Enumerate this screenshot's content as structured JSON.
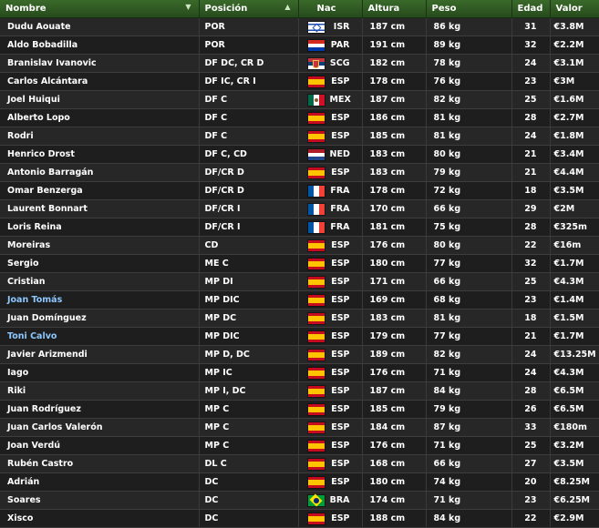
{
  "header": {
    "nombre": "Nombre",
    "posicion": "Posición",
    "nac": "Nac",
    "altura": "Altura",
    "peso": "Peso",
    "edad": "Edad",
    "valor": "Valor"
  },
  "flag_colors": {
    "ISR": [
      "#ffffff",
      "#1f4fb5"
    ],
    "PAR": [
      "#d52b1e",
      "#ffffff",
      "#0038a8"
    ],
    "SCG": [
      "#c6363c",
      "#0c4076",
      "#ffffff"
    ],
    "ESP": [
      "#c60b1e",
      "#ffc400",
      "#c60b1e"
    ],
    "MEX": [
      "#006847",
      "#ffffff",
      "#ce1126"
    ],
    "NED": [
      "#ae1c28",
      "#ffffff",
      "#21468b"
    ],
    "FRA": [
      "#0055a4",
      "#ffffff",
      "#ef4135"
    ],
    "BRA": [
      "#009c3b",
      "#ffdf00",
      "#002776"
    ]
  },
  "players": [
    {
      "name": "Dudu Aouate",
      "pos": "POR",
      "nac": "ISR",
      "altura": "187 cm",
      "peso": "86 kg",
      "edad": "31",
      "valor": "€3.8M",
      "highlight": false
    },
    {
      "name": "Aldo Bobadilla",
      "pos": "POR",
      "nac": "PAR",
      "altura": "191 cm",
      "peso": "89 kg",
      "edad": "32",
      "valor": "€2.2M",
      "highlight": false
    },
    {
      "name": "Branislav Ivanovic",
      "pos": "DF DC, CR D",
      "nac": "SCG",
      "altura": "182 cm",
      "peso": "78 kg",
      "edad": "24",
      "valor": "€3.1M",
      "highlight": false
    },
    {
      "name": "Carlos Alcántara",
      "pos": "DF IC, CR I",
      "nac": "ESP",
      "altura": "178 cm",
      "peso": "76 kg",
      "edad": "23",
      "valor": "€3M",
      "highlight": false
    },
    {
      "name": "Joel Huiqui",
      "pos": "DF C",
      "nac": "MEX",
      "altura": "187 cm",
      "peso": "82 kg",
      "edad": "25",
      "valor": "€1.6M",
      "highlight": false
    },
    {
      "name": "Alberto Lopo",
      "pos": "DF C",
      "nac": "ESP",
      "altura": "186 cm",
      "peso": "81 kg",
      "edad": "28",
      "valor": "€2.7M",
      "highlight": false
    },
    {
      "name": "Rodri",
      "pos": "DF C",
      "nac": "ESP",
      "altura": "185 cm",
      "peso": "81 kg",
      "edad": "24",
      "valor": "€1.8M",
      "highlight": false
    },
    {
      "name": "Henrico Drost",
      "pos": "DF C, CD",
      "nac": "NED",
      "altura": "183 cm",
      "peso": "80 kg",
      "edad": "21",
      "valor": "€3.4M",
      "highlight": false
    },
    {
      "name": "Antonio Barragán",
      "pos": "DF/CR D",
      "nac": "ESP",
      "altura": "183 cm",
      "peso": "79 kg",
      "edad": "21",
      "valor": "€4.4M",
      "highlight": false
    },
    {
      "name": "Omar Benzerga",
      "pos": "DF/CR D",
      "nac": "FRA",
      "altura": "178 cm",
      "peso": "72 kg",
      "edad": "18",
      "valor": "€3.5M",
      "highlight": false
    },
    {
      "name": "Laurent Bonnart",
      "pos": "DF/CR I",
      "nac": "FRA",
      "altura": "170 cm",
      "peso": "66 kg",
      "edad": "29",
      "valor": "€2M",
      "highlight": false
    },
    {
      "name": "Loris Reina",
      "pos": "DF/CR I",
      "nac": "FRA",
      "altura": "181 cm",
      "peso": "75 kg",
      "edad": "28",
      "valor": "€325m",
      "highlight": false
    },
    {
      "name": "Moreiras",
      "pos": "CD",
      "nac": "ESP",
      "altura": "176 cm",
      "peso": "80 kg",
      "edad": "22",
      "valor": "€16m",
      "highlight": false
    },
    {
      "name": "Sergio",
      "pos": "ME C",
      "nac": "ESP",
      "altura": "180 cm",
      "peso": "77 kg",
      "edad": "32",
      "valor": "€1.7M",
      "highlight": false
    },
    {
      "name": "Cristian",
      "pos": "MP DI",
      "nac": "ESP",
      "altura": "171 cm",
      "peso": "66 kg",
      "edad": "25",
      "valor": "€4.3M",
      "highlight": false
    },
    {
      "name": "Joan Tomás",
      "pos": "MP DIC",
      "nac": "ESP",
      "altura": "169 cm",
      "peso": "68 kg",
      "edad": "23",
      "valor": "€1.4M",
      "highlight": true
    },
    {
      "name": "Juan Domínguez",
      "pos": "MP DC",
      "nac": "ESP",
      "altura": "183 cm",
      "peso": "81 kg",
      "edad": "18",
      "valor": "€1.5M",
      "highlight": false
    },
    {
      "name": "Toni Calvo",
      "pos": "MP DIC",
      "nac": "ESP",
      "altura": "179 cm",
      "peso": "77 kg",
      "edad": "21",
      "valor": "€1.7M",
      "highlight": true
    },
    {
      "name": "Javier Arizmendi",
      "pos": "MP D, DC",
      "nac": "ESP",
      "altura": "189 cm",
      "peso": "82 kg",
      "edad": "24",
      "valor": "€13.25M",
      "highlight": false
    },
    {
      "name": "Iago",
      "pos": "MP IC",
      "nac": "ESP",
      "altura": "176 cm",
      "peso": "71 kg",
      "edad": "24",
      "valor": "€4.3M",
      "highlight": false
    },
    {
      "name": "Riki",
      "pos": "MP I, DC",
      "nac": "ESP",
      "altura": "187 cm",
      "peso": "84 kg",
      "edad": "28",
      "valor": "€6.5M",
      "highlight": false
    },
    {
      "name": "Juan Rodríguez",
      "pos": "MP C",
      "nac": "ESP",
      "altura": "185 cm",
      "peso": "79 kg",
      "edad": "26",
      "valor": "€6.5M",
      "highlight": false
    },
    {
      "name": "Juan Carlos Valerón",
      "pos": "MP C",
      "nac": "ESP",
      "altura": "184 cm",
      "peso": "87 kg",
      "edad": "33",
      "valor": "€180m",
      "highlight": false
    },
    {
      "name": "Joan Verdú",
      "pos": "MP C",
      "nac": "ESP",
      "altura": "176 cm",
      "peso": "71 kg",
      "edad": "25",
      "valor": "€3.2M",
      "highlight": false
    },
    {
      "name": "Rubén Castro",
      "pos": "DL C",
      "nac": "ESP",
      "altura": "168 cm",
      "peso": "66 kg",
      "edad": "27",
      "valor": "€3.5M",
      "highlight": false
    },
    {
      "name": "Adrián",
      "pos": "DC",
      "nac": "ESP",
      "altura": "180 cm",
      "peso": "74 kg",
      "edad": "20",
      "valor": "€8.25M",
      "highlight": false
    },
    {
      "name": "Soares",
      "pos": "DC",
      "nac": "BRA",
      "altura": "174 cm",
      "peso": "71 kg",
      "edad": "23",
      "valor": "€6.25M",
      "highlight": false
    },
    {
      "name": "Xisco",
      "pos": "DC",
      "nac": "ESP",
      "altura": "188 cm",
      "peso": "84 kg",
      "edad": "22",
      "valor": "€2.9M",
      "highlight": false
    }
  ]
}
